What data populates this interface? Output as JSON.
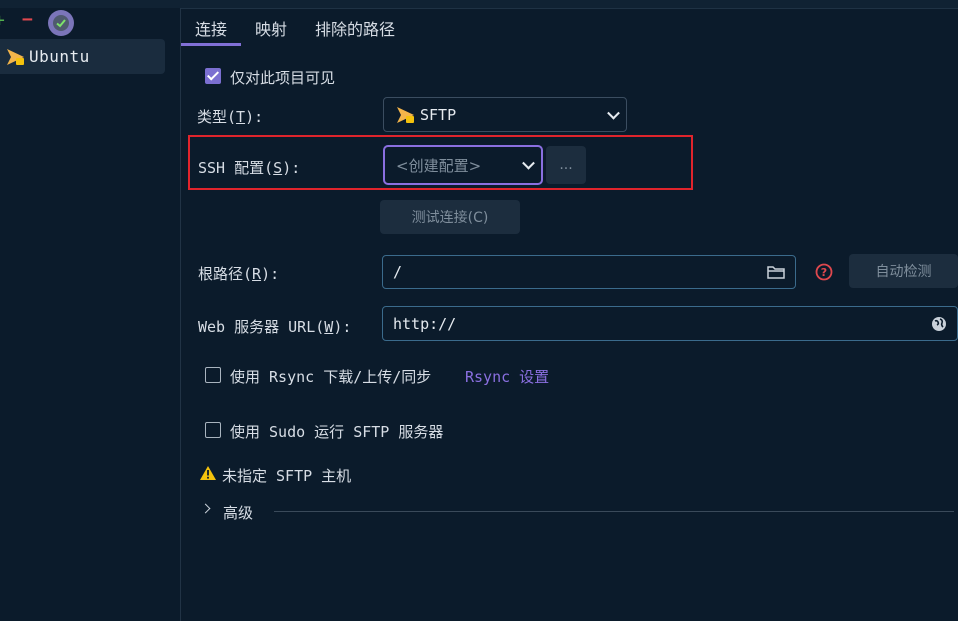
{
  "sidebar": {
    "items": [
      {
        "label": "Ubuntu",
        "icon": "sftp-icon"
      }
    ]
  },
  "tabs": [
    {
      "label": "连接",
      "active": true
    },
    {
      "label": "映射",
      "active": false
    },
    {
      "label": "排除的路径",
      "active": false
    }
  ],
  "form": {
    "visible_only": {
      "label": "仅对此项目可见",
      "checked": true
    },
    "type": {
      "label_pre": "类型(",
      "mnemonic": "T",
      "label_post": "):",
      "value": "SFTP"
    },
    "ssh": {
      "label_pre": "SSH 配置(",
      "mnemonic": "S",
      "label_post": "):",
      "placeholder": "<创建配置>",
      "more_label": "..."
    },
    "test_button": "测试连接(C)",
    "root": {
      "label_pre": "根路径(",
      "mnemonic": "R",
      "label_post": "):",
      "value": "/",
      "autodetect_label": "自动检测"
    },
    "web": {
      "label_pre": "Web 服务器 URL(",
      "mnemonic": "W",
      "label_post": "):",
      "value": "http://"
    },
    "rsync": {
      "label": "使用 Rsync 下载/上传/同步",
      "link": "Rsync 设置",
      "checked": false
    },
    "sudo": {
      "label": "使用 Sudo 运行 SFTP 服务器",
      "checked": false
    },
    "warning": "未指定 SFTP 主机",
    "advanced": "高级"
  },
  "colors": {
    "background": "#0b1b2b",
    "accent": "#8170d6",
    "link": "#8a6fe0",
    "warning": "#f4c20d",
    "error_outline": "#e0242c"
  }
}
